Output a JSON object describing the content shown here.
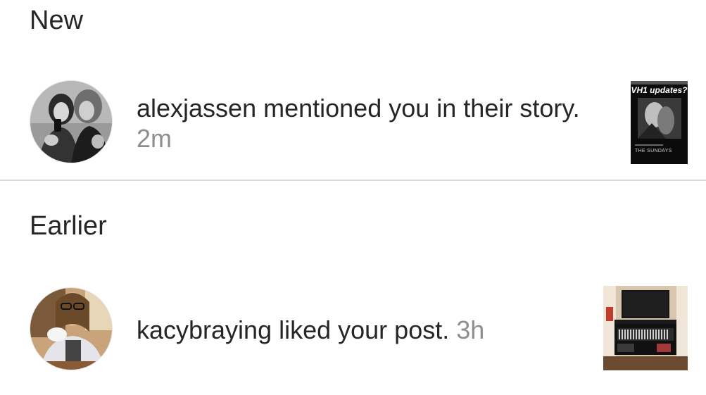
{
  "sections": {
    "new_title": "New",
    "earlier_title": "Earlier"
  },
  "notifications": [
    {
      "username": "alexjassen",
      "action": " mentioned you in their story.",
      "time": "2m",
      "avatar_icon": "user-photo-avatar",
      "thumbnail_icon": "story-thumbnail",
      "thumbnail_headline": "VH1 updates?",
      "thumbnail_footer": "THE SUNDAYS"
    },
    {
      "username": "kacybraying",
      "action": " liked your post.",
      "time": "3h",
      "avatar_icon": "user-photo-avatar",
      "thumbnail_icon": "post-thumbnail"
    }
  ],
  "colors": {
    "text": "#262626",
    "secondary_text": "#8e8e8e",
    "divider": "#dbdbdb",
    "background": "#ffffff"
  }
}
